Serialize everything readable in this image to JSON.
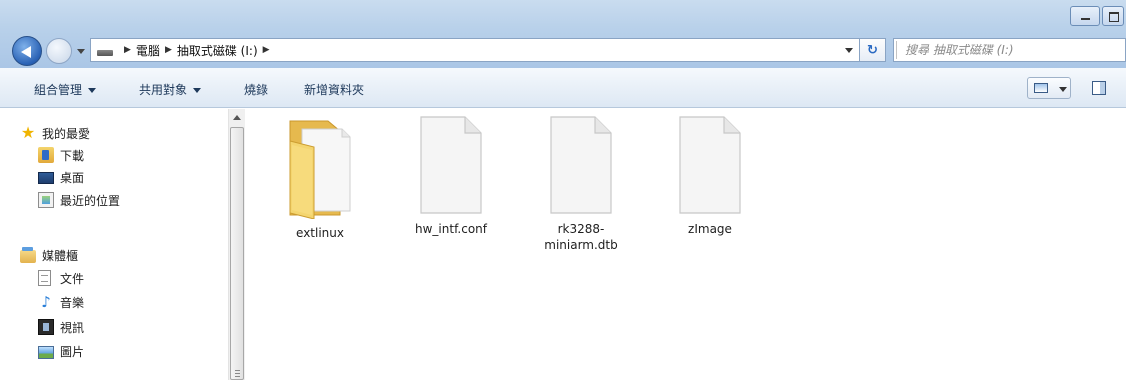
{
  "window": {
    "minimize_label": "",
    "maximize_label": ""
  },
  "address": {
    "crumbs": [
      "電腦",
      "抽取式磁碟 (I:)"
    ]
  },
  "search": {
    "placeholder": "搜尋 抽取式磁碟 (I:)"
  },
  "toolbar": {
    "organize": "組合管理",
    "share": "共用對象",
    "burn": "燒錄",
    "new_folder": "新增資料夾"
  },
  "nav": {
    "favorites": {
      "label": "我的最愛",
      "items": [
        {
          "label": "下載",
          "icon": "download-icon"
        },
        {
          "label": "桌面",
          "icon": "desktop-icon"
        },
        {
          "label": "最近的位置",
          "icon": "recent-places-icon"
        }
      ]
    },
    "libraries": {
      "label": "媒體櫃",
      "items": [
        {
          "label": "文件",
          "icon": "documents-icon"
        },
        {
          "label": "音樂",
          "icon": "music-icon"
        },
        {
          "label": "視訊",
          "icon": "video-icon"
        },
        {
          "label": "圖片",
          "icon": "pictures-icon"
        }
      ]
    }
  },
  "files": [
    {
      "name": "extlinux",
      "type": "folder",
      "icon": "folder-icon"
    },
    {
      "name": "hw_intf.conf",
      "type": "file",
      "icon": "generic-file-icon"
    },
    {
      "name": "rk3288-miniarm.dtb",
      "type": "file",
      "icon": "generic-file-icon"
    },
    {
      "name": "zImage",
      "type": "file",
      "icon": "generic-file-icon"
    }
  ],
  "colors": {
    "title_gradient_top": "#c9dcef",
    "toolbar_text": "#1e395b",
    "folder_yellow": "#f2cf63"
  }
}
